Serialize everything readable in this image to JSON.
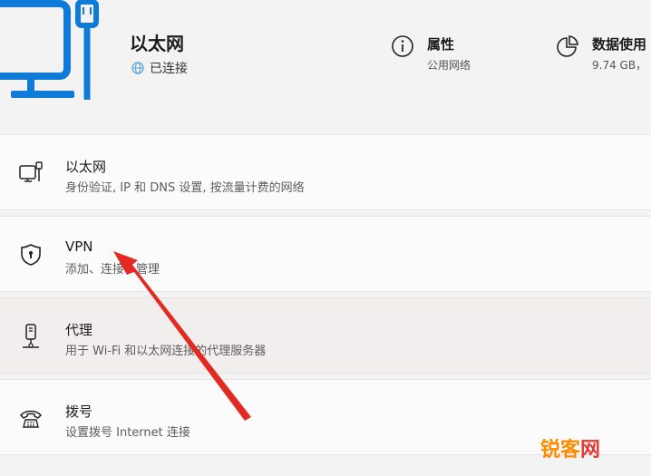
{
  "header": {
    "title": "以太网",
    "status": "已连接",
    "properties": {
      "label": "属性",
      "value": "公用网络"
    },
    "data_usage": {
      "label": "数据使用",
      "value": "9.74 GB，"
    }
  },
  "items": [
    {
      "title": "以太网",
      "subtitle": "身份验证, IP 和 DNS 设置, 按流量计费的网络",
      "icon": "ethernet-icon"
    },
    {
      "title": "VPN",
      "subtitle": "添加、连接、管理",
      "icon": "shield-icon"
    },
    {
      "title": "代理",
      "subtitle": "用于 Wi-Fi 和以太网连接的代理服务器",
      "icon": "proxy-icon"
    },
    {
      "title": "拨号",
      "subtitle": "设置拨号 Internet 连接",
      "icon": "dialup-icon"
    }
  ],
  "watermark": {
    "part1": "锐客",
    "part2": "网"
  },
  "colors": {
    "accent": "#0f7bd8",
    "arrow": "#e32a22",
    "status_icon": "#6aa9d9"
  }
}
